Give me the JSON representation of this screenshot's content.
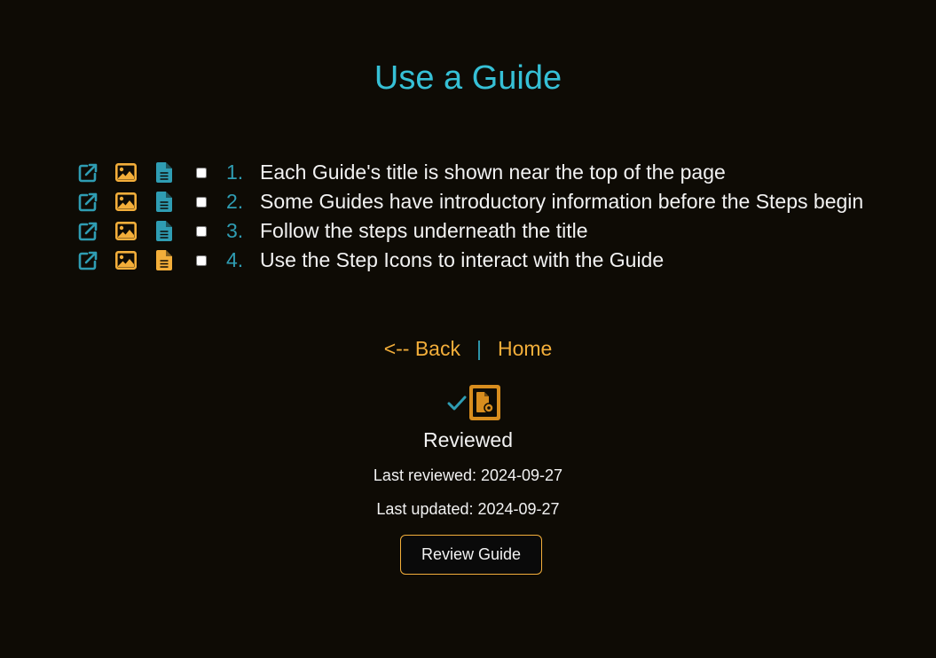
{
  "page": {
    "title": "Use a Guide"
  },
  "colors": {
    "accent_cyan": "#36c0d6",
    "accent_teal": "#2f9db3",
    "accent_orange": "#f3ae3a",
    "background": "#0e0b05"
  },
  "steps": [
    {
      "number": "1.",
      "text": "Each Guide's title is shown near the top of the page",
      "icons": [
        "external-link-icon",
        "image-icon",
        "document-icon"
      ],
      "doc_icon_color": "teal"
    },
    {
      "number": "2.",
      "text": "Some Guides have introductory information before the Steps begin",
      "icons": [
        "external-link-icon",
        "image-icon",
        "document-icon"
      ],
      "doc_icon_color": "teal"
    },
    {
      "number": "3.",
      "text": "Follow the steps underneath the title",
      "icons": [
        "external-link-icon",
        "image-icon",
        "document-icon"
      ],
      "doc_icon_color": "teal"
    },
    {
      "number": "4.",
      "text": "Use the Step Icons to interact with the Guide",
      "icons": [
        "external-link-icon",
        "image-icon",
        "document-icon"
      ],
      "doc_icon_color": "orange"
    }
  ],
  "nav": {
    "back_label": "<-- Back",
    "separator": "|",
    "home_label": "Home"
  },
  "review": {
    "icons": [
      "checkmark-icon",
      "file-review-icon"
    ],
    "status": "Reviewed",
    "last_reviewed": "Last reviewed: 2024-09-27",
    "last_updated": "Last updated: 2024-09-27",
    "button_label": "Review Guide"
  }
}
